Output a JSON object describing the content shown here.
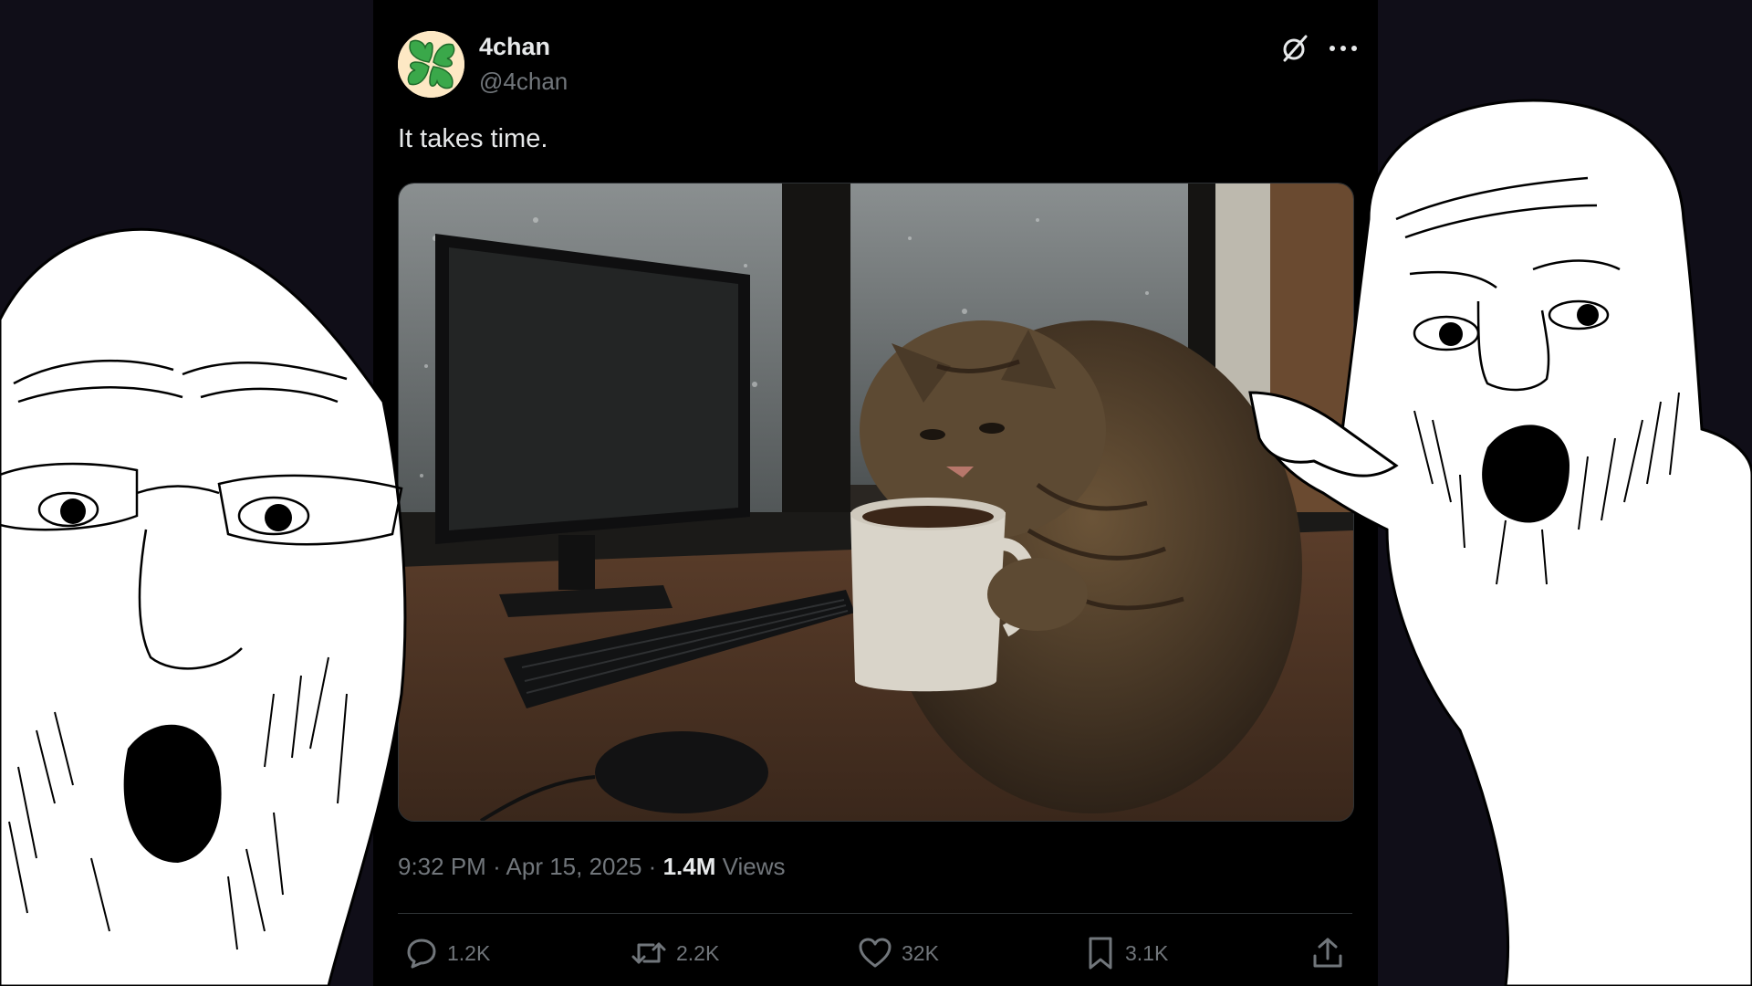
{
  "tweet": {
    "author_name": "4chan",
    "author_handle": "@4chan",
    "text": "It takes time.",
    "time": "9:32 PM",
    "date": "Apr 15, 2025",
    "separator": "·",
    "views_count": "1.4M",
    "views_label": "Views",
    "media_description": "cat sipping coffee at a desk by a rainy window"
  },
  "actions": {
    "replies": "1.2K",
    "reposts": "2.2K",
    "likes": "32K",
    "bookmarks": "3.1K"
  },
  "icons": [
    "grok-icon",
    "more-icon",
    "reply-icon",
    "repost-icon",
    "like-icon",
    "bookmark-icon",
    "share-icon"
  ],
  "colors": {
    "background": "#100e18",
    "card": "#000000",
    "text_primary": "#e7e9ea",
    "text_secondary": "#71767b",
    "clover_green": "#3aa84a",
    "avatar_bg": "#fde8c4"
  }
}
